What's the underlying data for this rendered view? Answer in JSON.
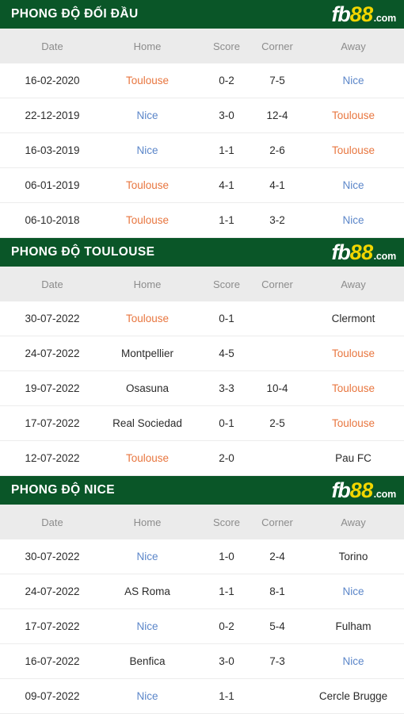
{
  "brand": {
    "logo_fb": "fb",
    "logo_88": "88",
    "logo_com": ".com",
    "green": "#0a5628",
    "yellow": "#f2d600",
    "orange": "#e8763f",
    "blue": "#5b86c9",
    "score_red": "#c94b4b"
  },
  "columns": {
    "date": "Date",
    "home": "Home",
    "score": "Score",
    "corner": "Corner",
    "away": "Away"
  },
  "sections": [
    {
      "title": "PHONG ĐỘ ĐỐI ĐẦU",
      "rows": [
        {
          "date": "16-02-2020",
          "home": "Toulouse",
          "home_style": "team-orange",
          "score": "0-2",
          "corner": "7-5",
          "away": "Nice",
          "away_style": "team-blue"
        },
        {
          "date": "22-12-2019",
          "home": "Nice",
          "home_style": "team-blue",
          "score": "3-0",
          "corner": "12-4",
          "away": "Toulouse",
          "away_style": "team-orange"
        },
        {
          "date": "16-03-2019",
          "home": "Nice",
          "home_style": "team-blue",
          "score": "1-1",
          "corner": "2-6",
          "away": "Toulouse",
          "away_style": "team-orange"
        },
        {
          "date": "06-01-2019",
          "home": "Toulouse",
          "home_style": "team-orange",
          "score": "4-1",
          "corner": "4-1",
          "away": "Nice",
          "away_style": "team-blue"
        },
        {
          "date": "06-10-2018",
          "home": "Toulouse",
          "home_style": "team-orange",
          "score": "1-1",
          "corner": "3-2",
          "away": "Nice",
          "away_style": "team-blue"
        }
      ]
    },
    {
      "title": "PHONG ĐỘ TOULOUSE",
      "rows": [
        {
          "date": "30-07-2022",
          "home": "Toulouse",
          "home_style": "team-orange",
          "score": "0-1",
          "corner": "",
          "away": "Clermont",
          "away_style": "team-plain"
        },
        {
          "date": "24-07-2022",
          "home": "Montpellier",
          "home_style": "team-plain",
          "score": "4-5",
          "corner": "",
          "away": "Toulouse",
          "away_style": "team-orange"
        },
        {
          "date": "19-07-2022",
          "home": "Osasuna",
          "home_style": "team-plain",
          "score": "3-3",
          "corner": "10-4",
          "away": "Toulouse",
          "away_style": "team-orange"
        },
        {
          "date": "17-07-2022",
          "home": "Real Sociedad",
          "home_style": "team-plain",
          "score": "0-1",
          "corner": "2-5",
          "away": "Toulouse",
          "away_style": "team-orange"
        },
        {
          "date": "12-07-2022",
          "home": "Toulouse",
          "home_style": "team-orange",
          "score": "2-0",
          "corner": "",
          "away": "Pau FC",
          "away_style": "team-plain"
        }
      ]
    },
    {
      "title": "PHONG ĐỘ NICE",
      "rows": [
        {
          "date": "30-07-2022",
          "home": "Nice",
          "home_style": "team-blue",
          "score": "1-0",
          "corner": "2-4",
          "away": "Torino",
          "away_style": "team-plain"
        },
        {
          "date": "24-07-2022",
          "home": "AS Roma",
          "home_style": "team-plain",
          "score": "1-1",
          "corner": "8-1",
          "away": "Nice",
          "away_style": "team-blue"
        },
        {
          "date": "17-07-2022",
          "home": "Nice",
          "home_style": "team-blue",
          "score": "0-2",
          "corner": "5-4",
          "away": "Fulham",
          "away_style": "team-plain"
        },
        {
          "date": "16-07-2022",
          "home": "Benfica",
          "home_style": "team-plain",
          "score": "3-0",
          "corner": "7-3",
          "away": "Nice",
          "away_style": "team-blue"
        },
        {
          "date": "09-07-2022",
          "home": "Nice",
          "home_style": "team-blue",
          "score": "1-1",
          "corner": "",
          "away": "Cercle Brugge",
          "away_style": "team-plain"
        }
      ]
    }
  ]
}
